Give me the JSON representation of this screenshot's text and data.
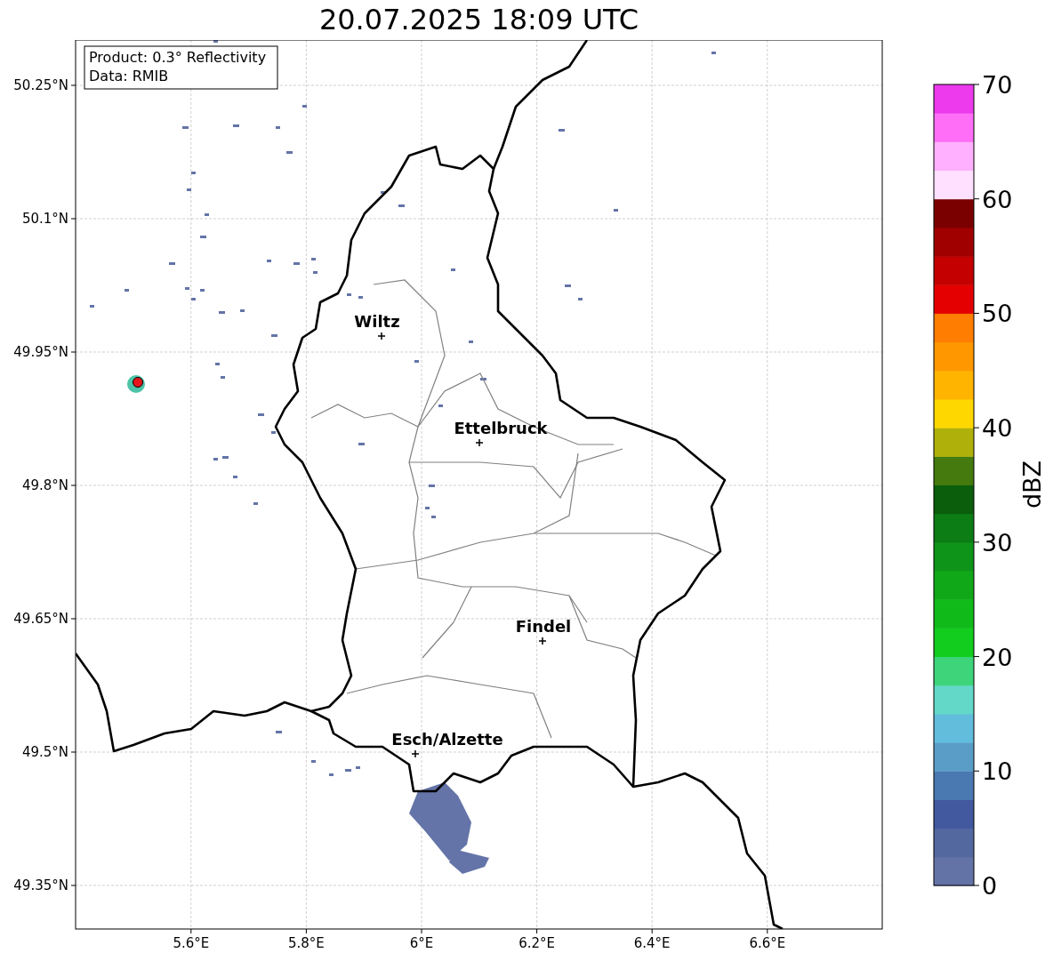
{
  "title": "20.07.2025 18:09 UTC",
  "map": {
    "info_lines": [
      "Product: 0.3° Reflectivity",
      "Data: RMIB"
    ],
    "lat_ticks": [
      "50.25°N",
      "50.1°N",
      "49.95°N",
      "49.8°N",
      "49.65°N",
      "49.5°N",
      "49.35°N"
    ],
    "lon_ticks": [
      "5.6°E",
      "5.8°E",
      "6°E",
      "6.2°E",
      "6.4°E",
      "6.6°E"
    ],
    "cities": [
      {
        "name": "Wiltz"
      },
      {
        "name": "Ettelbruck"
      },
      {
        "name": "Findel"
      },
      {
        "name": "Esch/Alzette"
      }
    ]
  },
  "colorbar": {
    "label": "dBZ",
    "ticks": [
      "70",
      "60",
      "50",
      "40",
      "30",
      "20",
      "10",
      "0"
    ]
  }
}
